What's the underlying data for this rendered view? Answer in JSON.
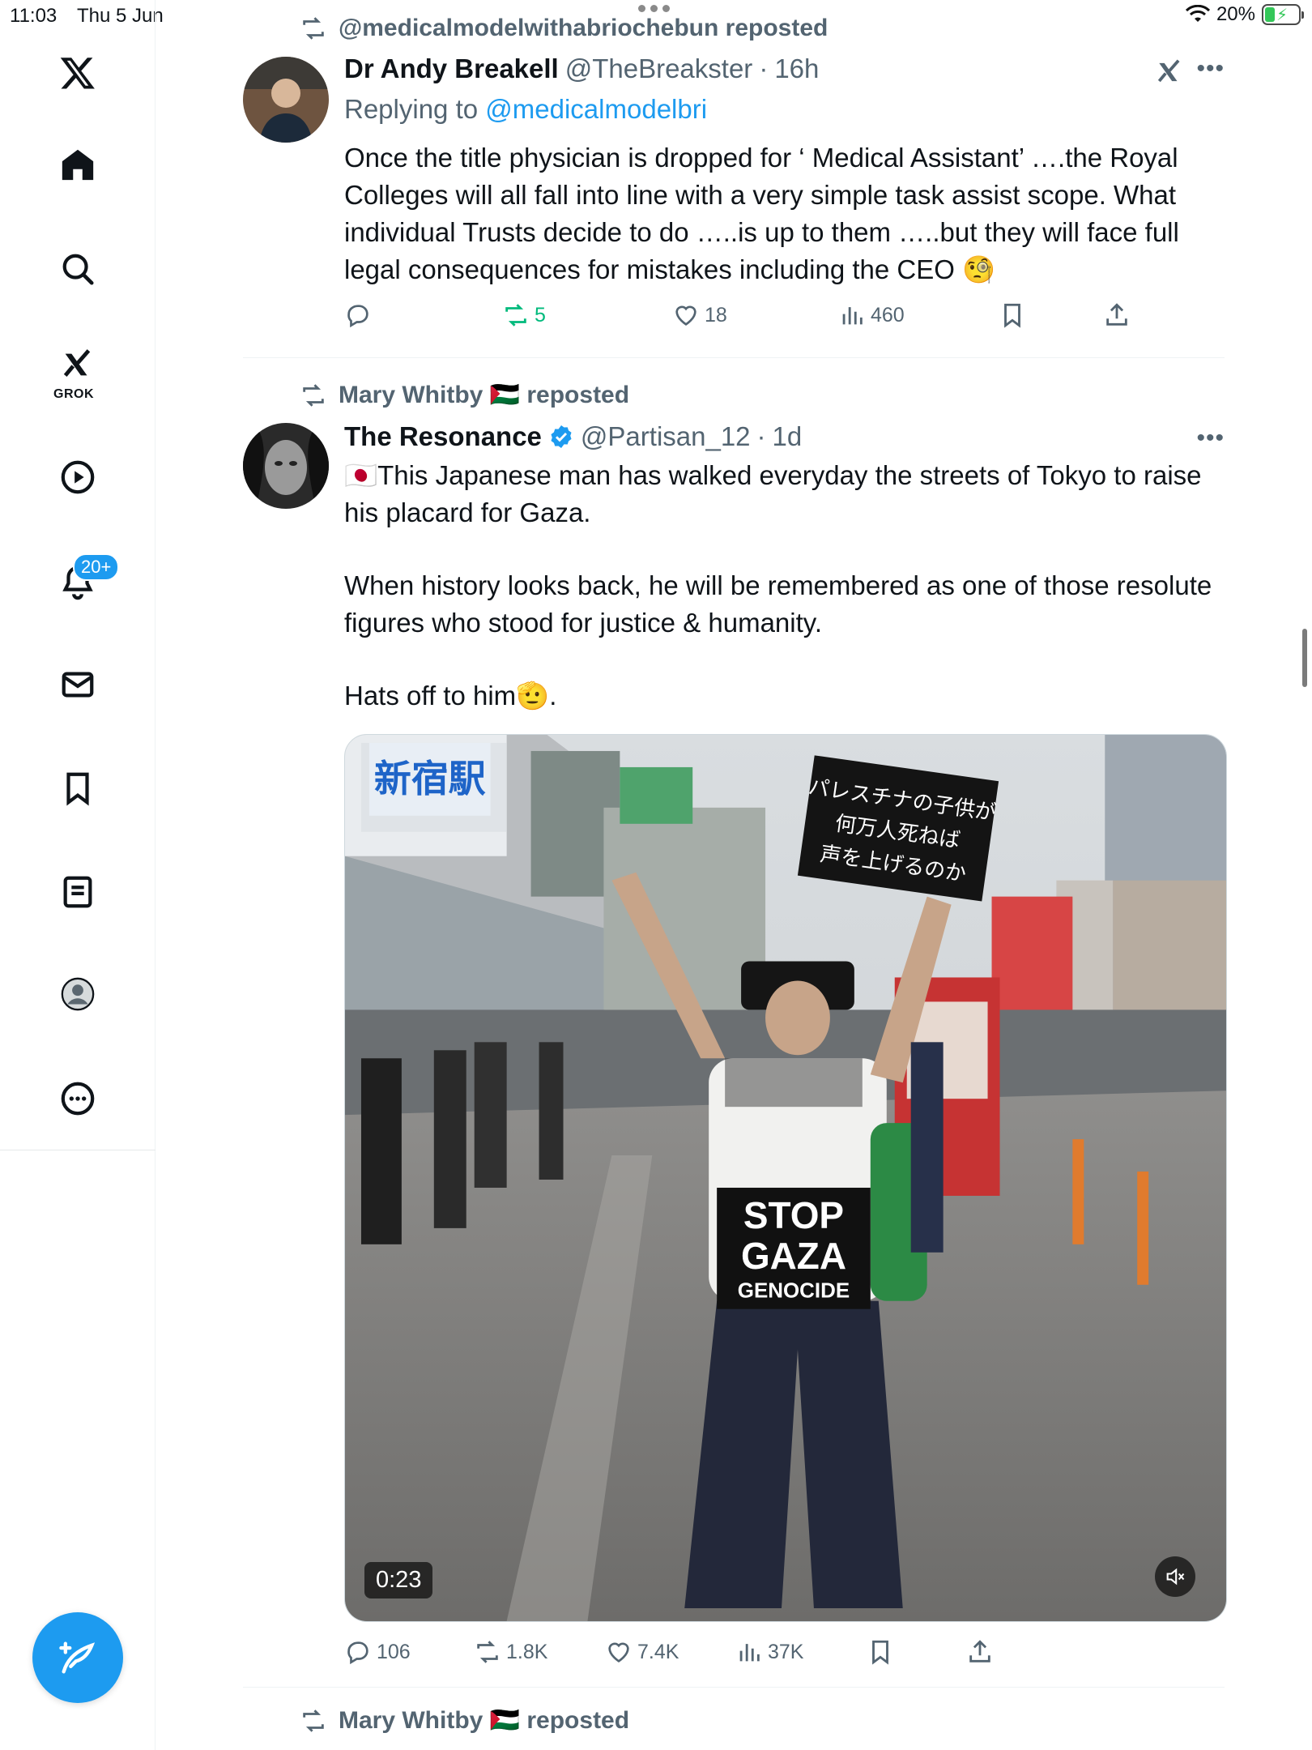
{
  "status_bar": {
    "time": "11:03",
    "date": "Thu 5 Jun",
    "battery": "20%"
  },
  "sidebar": {
    "items": [
      {
        "name": "x-logo-icon"
      },
      {
        "name": "home-icon"
      },
      {
        "name": "search-icon"
      },
      {
        "name": "grok-icon",
        "label": "GROK"
      },
      {
        "name": "video-icon"
      },
      {
        "name": "notifications-icon",
        "badge": "20+"
      },
      {
        "name": "messages-icon"
      },
      {
        "name": "bookmarks-icon"
      },
      {
        "name": "lists-icon"
      },
      {
        "name": "profile-icon"
      },
      {
        "name": "more-icon"
      }
    ],
    "compose_icon": "compose-icon"
  },
  "posts": [
    {
      "repost_by": "@medicalmodelwithabriochebun reposted",
      "name": "Dr Andy Breakell",
      "handle": "@TheBreakster",
      "time": "16h",
      "replying_prefix": "Replying to",
      "replying_to": "@medicalmodelbri",
      "text": [
        "Once the title physician is dropped for ‘ Medical Assistant’ ….the Royal Colleges will all fall into line with a very simple task assist scope. What individual Trusts decide to do …..is up to them …..but they will face full legal consequences for mistakes including the CEO 🧐"
      ],
      "stats": {
        "replies": "",
        "reposts": "5",
        "likes": "18",
        "views": "460"
      }
    },
    {
      "repost_by": "Mary Whitby 🇵🇸 reposted",
      "name": "The Resonance",
      "handle": "@Partisan_12",
      "time": "1d",
      "text": [
        "🇯🇵This Japanese man has walked everyday the streets of Tokyo to raise his placard for Gaza.",
        "When history looks back, he will be remembered as one of those resolute figures who stood for justice & humanity.",
        "Hats off to him🫡."
      ],
      "media": {
        "duration": "0:23",
        "placard_text": "STOP GAZA GENOCIDE",
        "sign_text": "パレスチナの子供が何万人死ねば声を上げるのか"
      },
      "stats": {
        "replies": "106",
        "reposts": "1.8K",
        "likes": "7.4K",
        "views": "37K"
      }
    },
    {
      "repost_by": "Mary Whitby 🇵🇸 reposted"
    }
  ],
  "colors": {
    "accent": "#1d9bf0",
    "repost_green": "#00ba7c",
    "muted": "#536471"
  }
}
